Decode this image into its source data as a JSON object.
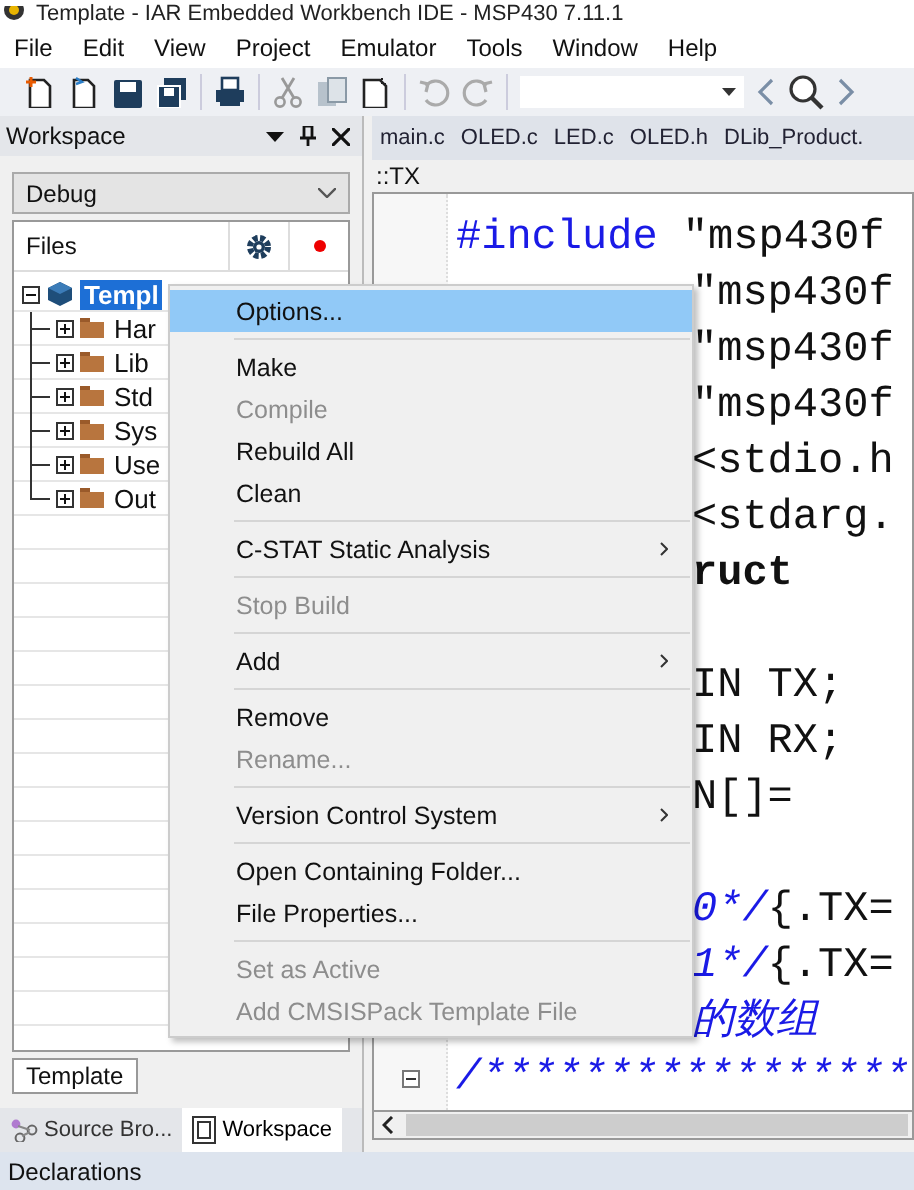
{
  "window": {
    "title": "Template - IAR Embedded Workbench IDE - MSP430 7.11.1"
  },
  "menu_bar": [
    "File",
    "Edit",
    "View",
    "Project",
    "Emulator",
    "Tools",
    "Window",
    "Help"
  ],
  "workspace": {
    "title": "Workspace",
    "configuration": "Debug",
    "files_header": "Files",
    "tree": [
      {
        "label": "Templ",
        "selected": true,
        "expanded": true,
        "children": [
          {
            "label": "Har",
            "selected": false,
            "expanded": false
          },
          {
            "label": "Lib",
            "selected": false,
            "expanded": false
          },
          {
            "label": "Std",
            "selected": false,
            "expanded": false
          },
          {
            "label": "Sys",
            "selected": false,
            "expanded": false
          },
          {
            "label": "Use",
            "selected": false,
            "expanded": false
          },
          {
            "label": "Out",
            "selected": false,
            "expanded": false
          }
        ]
      }
    ],
    "bottom_tab": "Template"
  },
  "panel_tabs": [
    {
      "label": "Source Bro...",
      "selected": false
    },
    {
      "label": "Workspace",
      "selected": true
    }
  ],
  "editor": {
    "tabs": [
      "main.c",
      "OLED.c",
      "LED.c",
      "OLED.h",
      "DLib_Product."
    ],
    "scope": "::TX",
    "lines": [
      {
        "kind": "full",
        "segments": [
          {
            "text": "#include ",
            "kind": "keyword"
          },
          {
            "text": "\"msp430f",
            "kind": "plain"
          }
        ]
      },
      {
        "kind": "clipped",
        "segments": [
          {
            "text": "\"msp430f",
            "kind": "plain"
          }
        ]
      },
      {
        "kind": "clipped",
        "segments": [
          {
            "text": "\"msp430f",
            "kind": "plain"
          }
        ]
      },
      {
        "kind": "clipped",
        "segments": [
          {
            "text": "\"msp430f",
            "kind": "plain"
          }
        ]
      },
      {
        "kind": "clipped",
        "segments": [
          {
            "text": "<stdio.h",
            "kind": "plain"
          }
        ]
      },
      {
        "kind": "clipped",
        "segments": [
          {
            "text": "<stdarg.",
            "kind": "plain"
          }
        ]
      },
      {
        "kind": "clipped",
        "segments": [
          {
            "text": "ruct",
            "kind": "bold"
          }
        ]
      },
      {
        "kind": "blank"
      },
      {
        "kind": "clipped",
        "segments": [
          {
            "text": "IN TX;",
            "kind": "plain"
          }
        ]
      },
      {
        "kind": "clipped",
        "segments": [
          {
            "text": "IN RX;",
            "kind": "plain"
          }
        ]
      },
      {
        "kind": "clipped",
        "segments": [
          {
            "text": "N[]=",
            "kind": "plain"
          }
        ]
      },
      {
        "kind": "blank"
      },
      {
        "kind": "clipped",
        "segments": [
          {
            "text": "0*/",
            "kind": "comment"
          },
          {
            "text": "{.TX=",
            "kind": "plain"
          }
        ]
      },
      {
        "kind": "clipped",
        "segments": [
          {
            "text": "1*/",
            "kind": "comment"
          },
          {
            "text": "{.TX=",
            "kind": "plain"
          }
        ]
      },
      {
        "kind": "clipped",
        "segments": [
          {
            "text": "的数组",
            "kind": "comment"
          }
        ]
      },
      {
        "kind": "full",
        "segments": [
          {
            "text": "/*****************",
            "kind": "comment"
          }
        ]
      }
    ]
  },
  "context_menu": [
    {
      "kind": "item",
      "label": "Options...",
      "selected": true,
      "disabled": false,
      "submenu": false
    },
    {
      "kind": "separator"
    },
    {
      "kind": "item",
      "label": "Make",
      "selected": false,
      "disabled": false,
      "submenu": false
    },
    {
      "kind": "item",
      "label": "Compile",
      "selected": false,
      "disabled": true,
      "submenu": false
    },
    {
      "kind": "item",
      "label": "Rebuild All",
      "selected": false,
      "disabled": false,
      "submenu": false
    },
    {
      "kind": "item",
      "label": "Clean",
      "selected": false,
      "disabled": false,
      "submenu": false
    },
    {
      "kind": "separator"
    },
    {
      "kind": "item",
      "label": "C-STAT Static Analysis",
      "selected": false,
      "disabled": false,
      "submenu": true
    },
    {
      "kind": "separator"
    },
    {
      "kind": "item",
      "label": "Stop Build",
      "selected": false,
      "disabled": true,
      "submenu": false
    },
    {
      "kind": "separator"
    },
    {
      "kind": "item",
      "label": "Add",
      "selected": false,
      "disabled": false,
      "submenu": true
    },
    {
      "kind": "separator"
    },
    {
      "kind": "item",
      "label": "Remove",
      "selected": false,
      "disabled": false,
      "submenu": false
    },
    {
      "kind": "item",
      "label": "Rename...",
      "selected": false,
      "disabled": true,
      "submenu": false
    },
    {
      "kind": "separator"
    },
    {
      "kind": "item",
      "label": "Version Control System",
      "selected": false,
      "disabled": false,
      "submenu": true
    },
    {
      "kind": "separator"
    },
    {
      "kind": "item",
      "label": "Open Containing Folder...",
      "selected": false,
      "disabled": false,
      "submenu": false
    },
    {
      "kind": "item",
      "label": "File Properties...",
      "selected": false,
      "disabled": false,
      "submenu": false
    },
    {
      "kind": "separator"
    },
    {
      "kind": "item",
      "label": "Set as Active",
      "selected": false,
      "disabled": true,
      "submenu": false
    },
    {
      "kind": "item",
      "label": "Add CMSISPack Template File",
      "selected": false,
      "disabled": true,
      "submenu": false
    }
  ],
  "status_bar": {
    "label": "Declarations"
  }
}
